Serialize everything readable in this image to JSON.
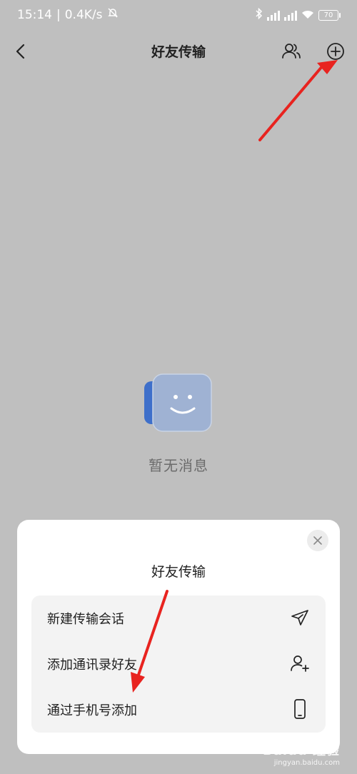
{
  "status_bar": {
    "time": "15:14",
    "network_speed": "0.4K/s",
    "battery": "70"
  },
  "nav": {
    "title": "好友传输"
  },
  "empty_state": {
    "text": "暂无消息"
  },
  "sheet": {
    "title": "好友传输",
    "options": [
      {
        "label": "新建传输会话",
        "icon": "send-icon"
      },
      {
        "label": "添加通讯录好友",
        "icon": "add-contact-icon"
      },
      {
        "label": "通过手机号添加",
        "icon": "phone-icon"
      }
    ]
  },
  "watermark": {
    "brand": "Baidu 经验",
    "url": "jingyan.baidu.com"
  },
  "colors": {
    "background_dim": "#bfbfbf",
    "sheet_bg": "#ffffff",
    "option_bg": "#f3f3f3",
    "annotation_arrow": "#e8231f",
    "illustration_blue": "#4a7bd0"
  }
}
